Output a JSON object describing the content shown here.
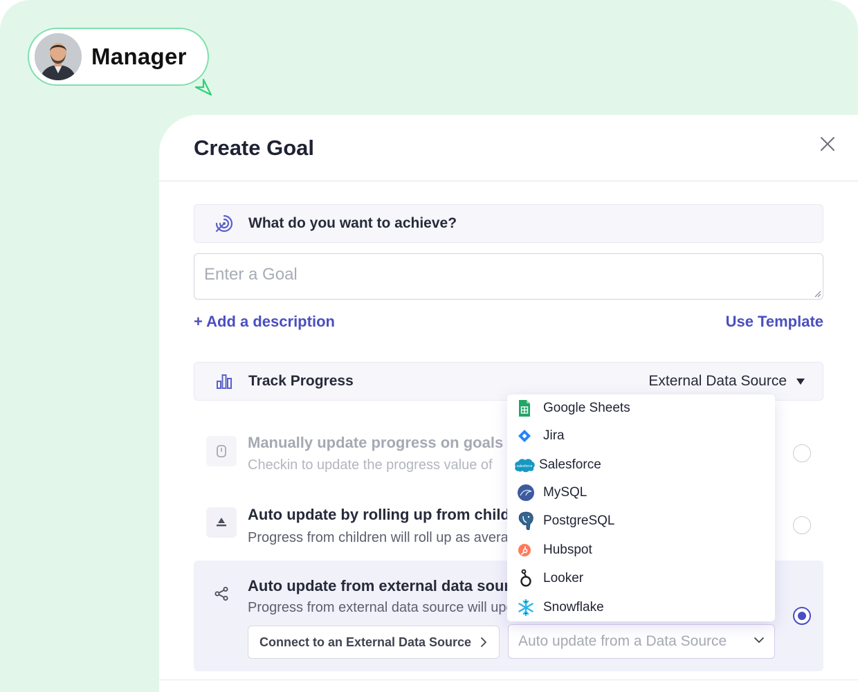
{
  "role_badge": {
    "label": "Manager"
  },
  "modal": {
    "title": "Create Goal",
    "goal_section": {
      "label": "What do you want to achieve?",
      "icon": "target-icon"
    },
    "goal_input": {
      "placeholder": "Enter a Goal",
      "value": ""
    },
    "add_description": "+ Add a description",
    "use_template": "Use Template",
    "track_progress": {
      "label": "Track Progress",
      "icon": "bar-chart-icon",
      "value": "External Data Source"
    },
    "options": [
      {
        "title": "Manually update progress on goals",
        "desc": "Checkin to update the progress value of",
        "icon": "checkin-icon",
        "state": "disabled",
        "selected": false
      },
      {
        "title": "Auto update by rolling up from children",
        "desc": "Progress from children will roll up as average",
        "icon": "rollup-icon",
        "state": "normal",
        "selected": false
      },
      {
        "title": "Auto update from external data source",
        "desc": "Progress from external data source will update",
        "icon": "share-nodes-icon",
        "state": "normal",
        "selected": true
      }
    ],
    "connect_button": "Connect to an External Data Source",
    "source_select": {
      "placeholder": "Auto update from a Data Source"
    }
  },
  "dropdown": {
    "items": [
      {
        "label": "Google Sheets",
        "icon": "google-sheets-icon",
        "color": "#22a565"
      },
      {
        "label": "Jira",
        "icon": "jira-icon",
        "color": "#2684ff"
      },
      {
        "label": "Salesforce",
        "icon": "salesforce-icon",
        "color": "#1798c1"
      },
      {
        "label": "MySQL",
        "icon": "mysql-icon",
        "color": "#4479a1"
      },
      {
        "label": "PostgreSQL",
        "icon": "postgresql-icon",
        "color": "#336791"
      },
      {
        "label": "Hubspot",
        "icon": "hubspot-icon",
        "color": "#ff7a59"
      },
      {
        "label": "Looker",
        "icon": "looker-icon",
        "color": "#1f1f1f"
      },
      {
        "label": "Snowflake",
        "icon": "snowflake-icon",
        "color": "#29b5e8"
      }
    ]
  },
  "colors": {
    "accent": "#4a4fc0",
    "background": "#e2f7ea",
    "badge_border": "#7fe0ad"
  }
}
